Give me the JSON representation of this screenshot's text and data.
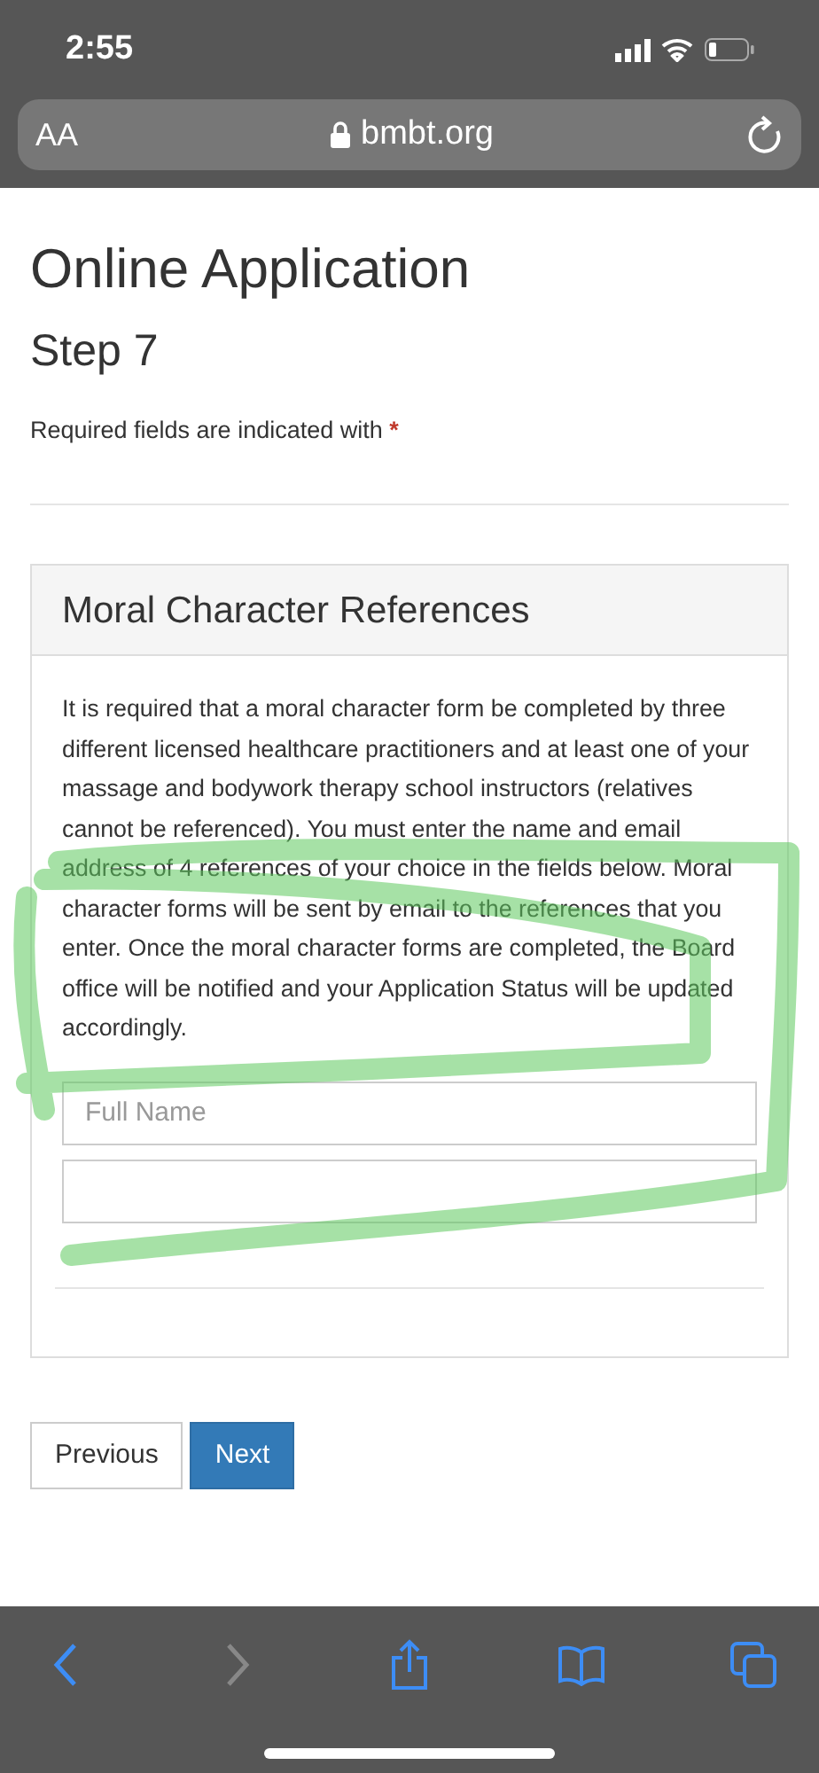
{
  "status_bar": {
    "time": "2:55"
  },
  "address_bar": {
    "text_size_button": "AA",
    "url": "bmbt.org"
  },
  "page": {
    "title": "Online Application",
    "step": "Step 7",
    "required_note": "Required fields are indicated with",
    "required_mark": "*"
  },
  "panel": {
    "heading": "Moral Character References",
    "paragraph": "It is required that a moral character form be completed by three different licensed healthcare practitioners and at least one of your massage and bodywork therapy school instructors (relatives cannot be referenced). You must enter the name and email address of 4 references of your choice in the fields below. Moral character forms will be sent by email to the references that you enter. Once the moral character forms are completed, the Board office will be notified and your Application Status will be updated accordingly.",
    "fields": [
      {
        "kind": "text",
        "placeholder": "Full Name"
      },
      {
        "kind": "text"
      }
    ]
  },
  "buttons": [
    {
      "label": "Previous",
      "kind": "secondary"
    },
    {
      "label": "Next",
      "kind": "primary"
    }
  ],
  "toolbar": [
    {
      "kind": "back",
      "disabled": false
    },
    {
      "kind": "forward",
      "disabled": true
    },
    {
      "kind": "share",
      "disabled": false
    },
    {
      "kind": "bookmarks",
      "disabled": false
    },
    {
      "kind": "tabs",
      "disabled": false
    }
  ]
}
